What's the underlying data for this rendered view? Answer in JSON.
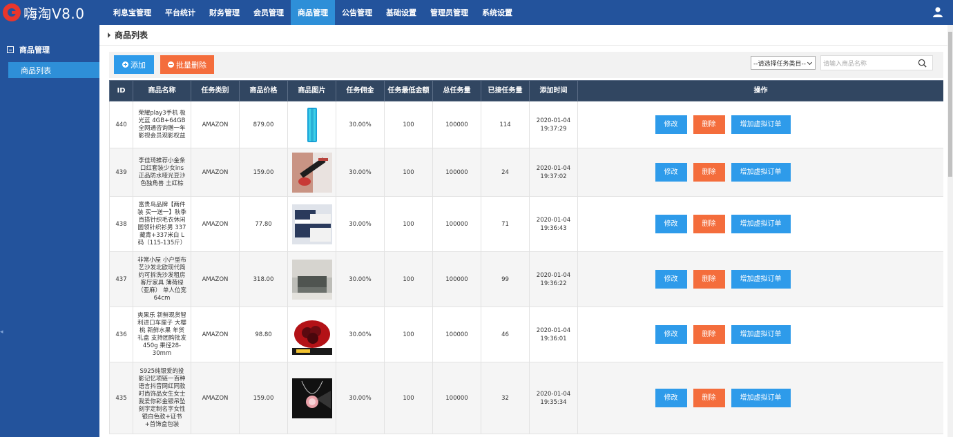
{
  "app": {
    "title": "嗨淘V8.0"
  },
  "topnav": [
    {
      "label": "利息宝管理",
      "active": false
    },
    {
      "label": "平台统计",
      "active": false
    },
    {
      "label": "财务管理",
      "active": false
    },
    {
      "label": "会员管理",
      "active": false
    },
    {
      "label": "商品管理",
      "active": true
    },
    {
      "label": "公告管理",
      "active": false
    },
    {
      "label": "基础设置",
      "active": false
    },
    {
      "label": "管理员管理",
      "active": false
    },
    {
      "label": "系统设置",
      "active": false
    }
  ],
  "sidebar": {
    "group_label": "商品管理",
    "items": [
      {
        "label": "商品列表",
        "active": true
      }
    ]
  },
  "page": {
    "title": "商品列表"
  },
  "toolbar": {
    "add_label": "添加",
    "batch_delete_label": "批量删除",
    "category_select": "--请选择任务类目--",
    "search_placeholder": "请输入商品名称"
  },
  "table": {
    "headers": [
      "ID",
      "商品名称",
      "任务类别",
      "商品价格",
      "商品图片",
      "任务佣金",
      "任务最低金额",
      "总任务量",
      "已接任务量",
      "添加时间",
      "操作"
    ],
    "actions": {
      "edit": "修改",
      "delete": "删除",
      "add_virtual": "增加虚拟订单"
    },
    "rows": [
      {
        "id": "440",
        "name": "荣耀play3手机 极光蓝 4GB+64GB 全网通咨询赠一年影视会员观影权益",
        "category": "AMAZON",
        "price": "879.00",
        "commission": "30.00%",
        "min_amount": "100",
        "total": "100000",
        "taken": "114",
        "date": "2020-01-04",
        "time": "19:37:29",
        "image": "phone-image"
      },
      {
        "id": "439",
        "name": "李佳琦推荐小金条口红套装少女ins正品防水哑光豆沙色独角兽 土红棕",
        "category": "AMAZON",
        "price": "159.00",
        "commission": "30.00%",
        "min_amount": "100",
        "total": "100000",
        "taken": "24",
        "date": "2020-01-04",
        "time": "19:37:02",
        "image": "lipstick-image"
      },
      {
        "id": "438",
        "name": "富贵鸟品牌【两件装 买一送一】秋季百搭针织毛衣休闲圆领针织衫男 337藏青+337米白 L码（115-135斤）",
        "category": "AMAZON",
        "price": "77.80",
        "commission": "30.00%",
        "min_amount": "100",
        "total": "100000",
        "taken": "71",
        "date": "2020-01-04",
        "time": "19:36:43",
        "image": "sweater-image"
      },
      {
        "id": "437",
        "name": "非常小屋 小户型布艺沙发北欧现代简约可拆洗沙发租房客厅家具 薄荷绿（亚麻） 单人位宽64cm",
        "category": "AMAZON",
        "price": "318.00",
        "commission": "30.00%",
        "min_amount": "100",
        "total": "100000",
        "taken": "99",
        "date": "2020-01-04",
        "time": "19:36:22",
        "image": "sofa-image"
      },
      {
        "id": "436",
        "name": "爽果乐 新鲜现货智利进口车厘子 大樱桃 新鲜水果 年货礼盒 支持团购批发 450g 果径28-30mm",
        "category": "AMAZON",
        "price": "98.80",
        "commission": "30.00%",
        "min_amount": "100",
        "total": "100000",
        "taken": "46",
        "date": "2020-01-04",
        "time": "19:36:01",
        "image": "cherry-image"
      },
      {
        "id": "435",
        "name": "S925纯银爱的投影记忆项链一百种语言抖音网红同款时尚饰品女生女士我爱你彩金银吊坠刻字定制名字女性银白色款+证书+首饰盒包装",
        "category": "AMAZON",
        "price": "159.00",
        "commission": "30.00%",
        "min_amount": "100",
        "total": "100000",
        "taken": "32",
        "date": "2020-01-04",
        "time": "19:35:34",
        "image": "necklace-image"
      }
    ]
  },
  "colors": {
    "topbar": "#23539c",
    "active_tab": "#2e8fd8",
    "header": "#314661",
    "primary": "#2e9bea",
    "danger": "#f46d3c"
  }
}
